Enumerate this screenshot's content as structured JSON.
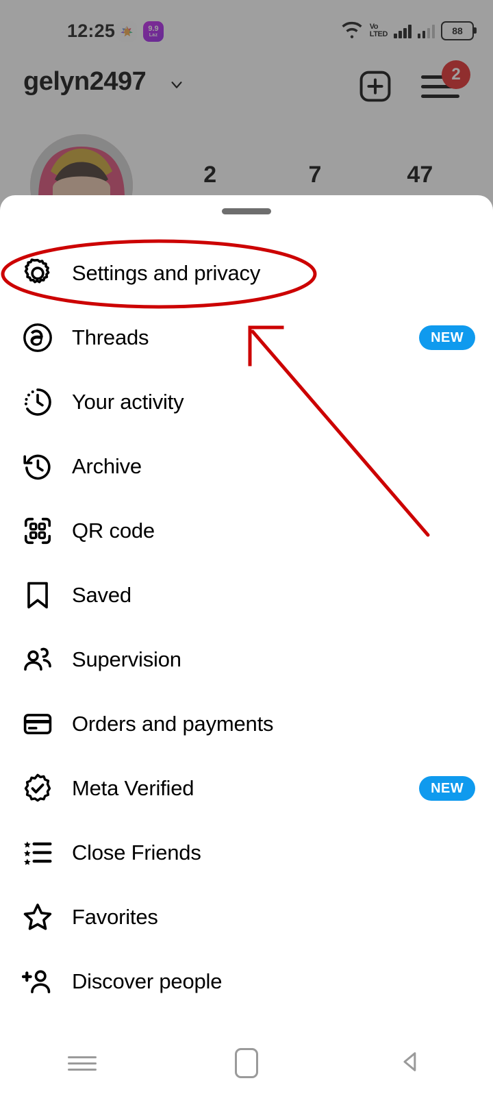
{
  "status_bar": {
    "time": "12:25",
    "app_icon_1": "samsung-gallery-icon",
    "app_icon_2_top": "9.9",
    "app_icon_2_bottom": "Laz",
    "wifi_icon": "wifi-icon",
    "volte_line1": "Vo",
    "volte_line2": "LTED",
    "signal_icon_1": "signal-bars-icon",
    "signal_icon_2": "signal-bars-secondary-icon",
    "battery_level": "88"
  },
  "profile_header": {
    "username": "gelyn2497",
    "chevron_icon": "chevron-down-icon",
    "add_icon": "plus-square-icon",
    "menu_icon": "hamburger-menu-icon",
    "notification_count": "2",
    "avatar": "profile-avatar",
    "stats": [
      "2",
      "7",
      "47"
    ]
  },
  "sheet": {
    "handle": "drag-handle",
    "items": [
      {
        "label": "Settings and privacy",
        "icon": "gear-icon",
        "badge": ""
      },
      {
        "label": "Threads",
        "icon": "threads-icon",
        "badge": "NEW"
      },
      {
        "label": "Your activity",
        "icon": "activity-clock-icon",
        "badge": ""
      },
      {
        "label": "Archive",
        "icon": "archive-clock-icon",
        "badge": ""
      },
      {
        "label": "QR code",
        "icon": "qr-code-icon",
        "badge": ""
      },
      {
        "label": "Saved",
        "icon": "bookmark-icon",
        "badge": ""
      },
      {
        "label": "Supervision",
        "icon": "people-icon",
        "badge": ""
      },
      {
        "label": "Orders and payments",
        "icon": "credit-card-icon",
        "badge": ""
      },
      {
        "label": "Meta Verified",
        "icon": "verified-badge-icon",
        "badge": "NEW"
      },
      {
        "label": "Close Friends",
        "icon": "star-list-icon",
        "badge": ""
      },
      {
        "label": "Favorites",
        "icon": "star-icon",
        "badge": ""
      },
      {
        "label": "Discover people",
        "icon": "person-add-icon",
        "badge": ""
      }
    ]
  },
  "nav_bar": {
    "recents_icon": "recents-icon",
    "home_icon": "home-icon",
    "back_icon": "back-icon"
  },
  "annotations": {
    "highlight_ellipse_target": "Settings and privacy",
    "arrow_points_to": "Settings and privacy",
    "color": "#cc0000"
  },
  "colors": {
    "accent_blue": "#0f9aee",
    "badge_red": "#e01c1c",
    "annotation_red": "#cc0000",
    "scrim": "#808080"
  }
}
